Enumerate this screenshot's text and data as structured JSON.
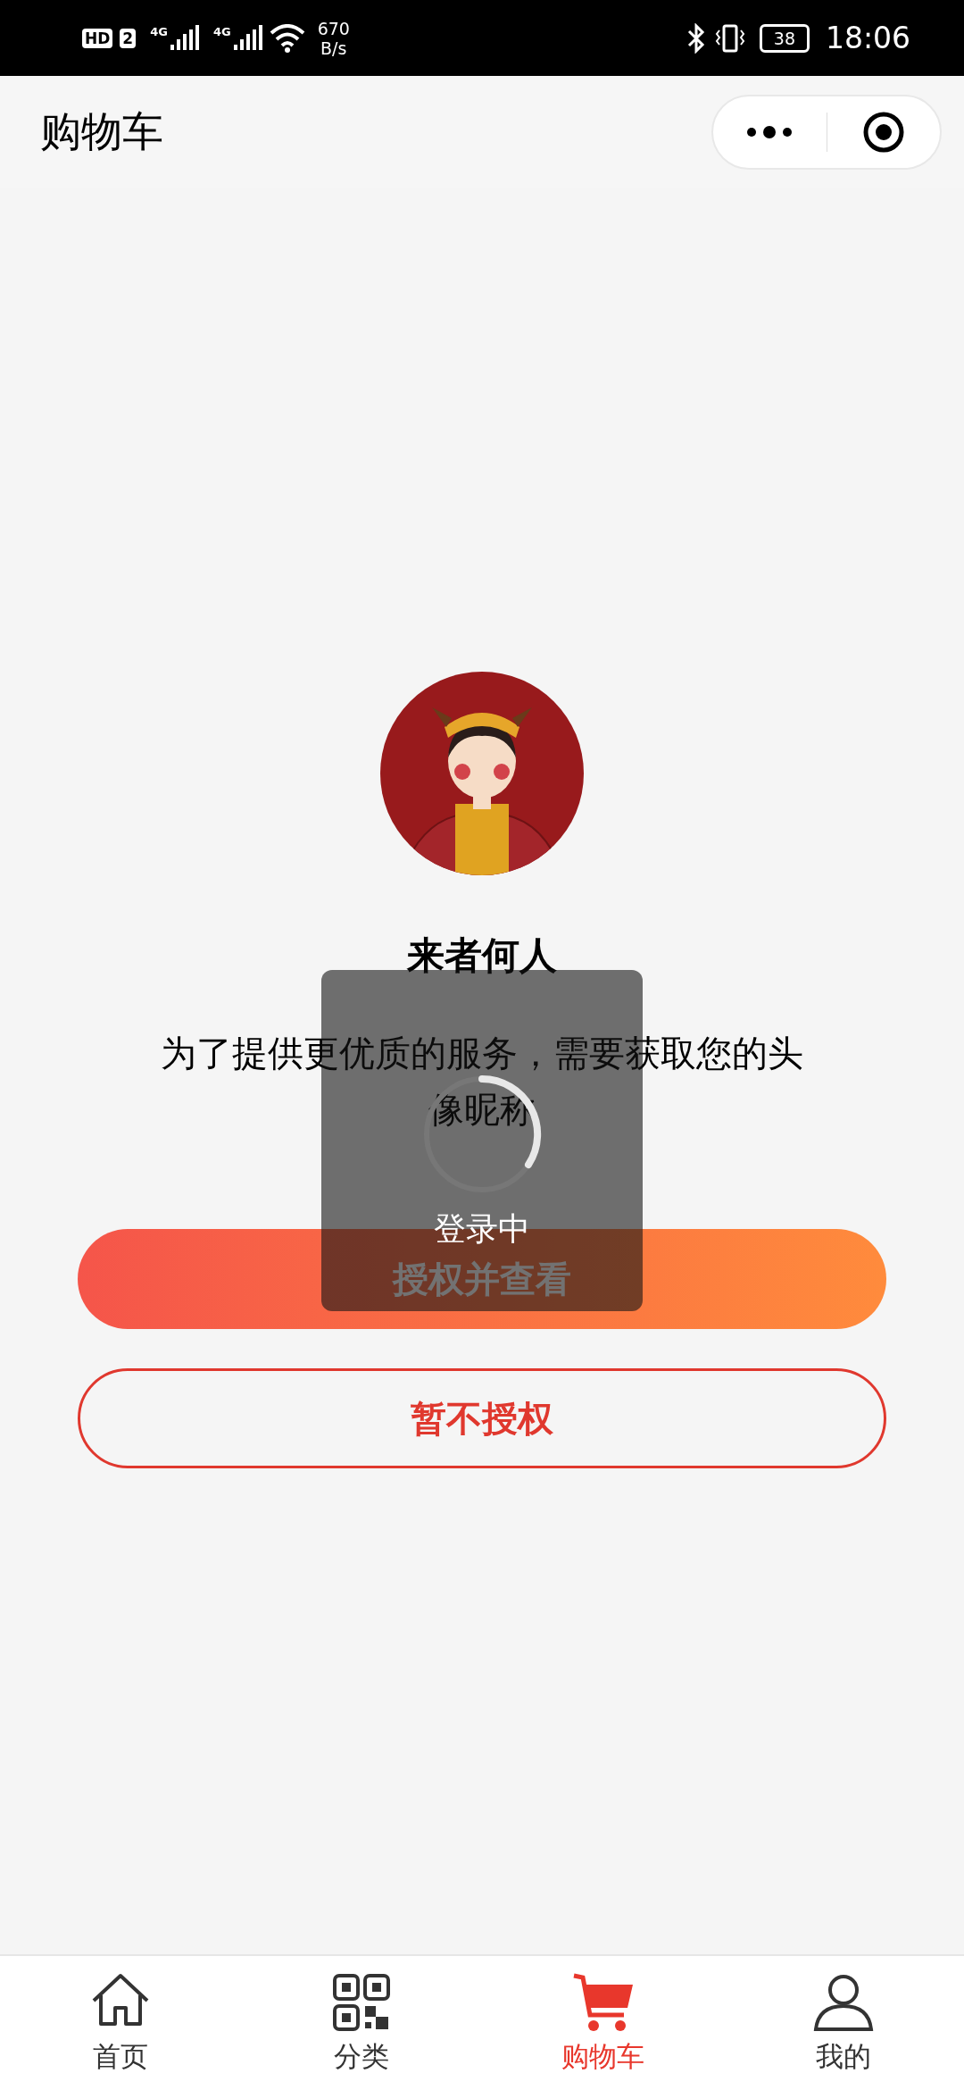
{
  "status_bar": {
    "badges": [
      "HD",
      "2"
    ],
    "signals": [
      "4G",
      "4G"
    ],
    "network_speed": "670",
    "speed_unit": "B/s",
    "battery": "38",
    "time": "18:06"
  },
  "nav_bar": {
    "title": "购物车"
  },
  "auth": {
    "title": "来者何人",
    "message": "为了提供更优质的服务，需要获取您的头像昵称",
    "buttons": [
      {
        "kind": "primary",
        "label": "授权并查看"
      },
      {
        "kind": "outline",
        "label": "暂不授权"
      }
    ]
  },
  "toast": {
    "text": "登录中",
    "loading": true
  },
  "tab_bar": [
    {
      "kind": "home",
      "label": "首页",
      "selected": false
    },
    {
      "kind": "category",
      "label": "分类",
      "selected": false
    },
    {
      "kind": "cart",
      "label": "购物车",
      "selected": true
    },
    {
      "kind": "profile",
      "label": "我的",
      "selected": false
    }
  ]
}
